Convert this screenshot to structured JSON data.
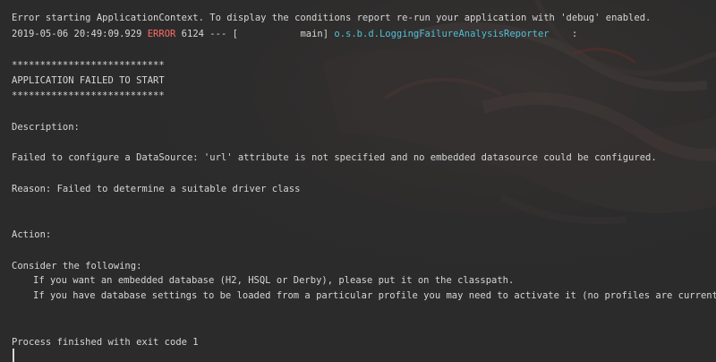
{
  "console": {
    "line1": "Error starting ApplicationContext. To display the conditions report re-run your application with 'debug' enabled.",
    "log_line": {
      "timestamp": "2019-05-06 20:49:09.929",
      "level": "ERROR",
      "pid": "6124",
      "separator": "---",
      "thread": "[           main]",
      "logger": "o.s.b.d.LoggingFailureAnalysisReporter",
      "suffix": ":"
    },
    "stars_top": "***************************",
    "failed_title": "APPLICATION FAILED TO START",
    "stars_bottom": "***************************",
    "description_label": "Description:",
    "description_text": "Failed to configure a DataSource: 'url' attribute is not specified and no embedded datasource could be configured.",
    "reason_text": "Reason: Failed to determine a suitable driver class",
    "action_label": "Action:",
    "consider_text": "Consider the following:",
    "option1": "If you want an embedded database (H2, HSQL or Derby), please put it on the classpath.",
    "option2": "If you have database settings to be loaded from a particular profile you may need to activate it (no profiles are currently active).",
    "exit_text": "Process finished with exit code 1"
  },
  "colors": {
    "background": "#2b2b2b",
    "text": "#d6d6d6",
    "error": "#ff6b68",
    "logger": "#4fc1d6"
  }
}
